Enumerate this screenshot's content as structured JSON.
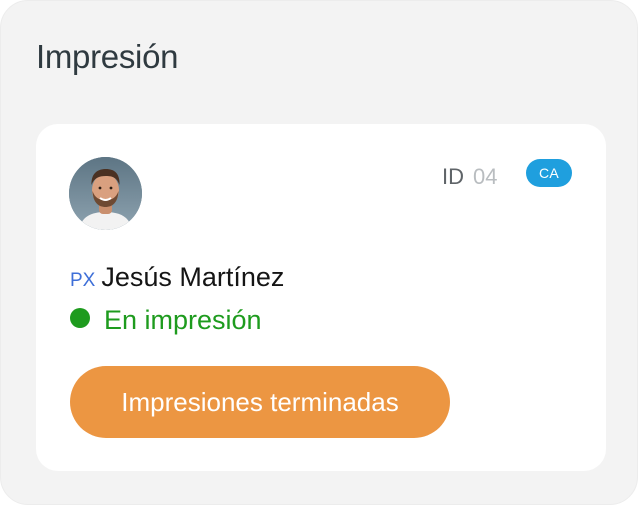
{
  "panel": {
    "title": "Impresión"
  },
  "card": {
    "avatar_icon": "person-avatar-photo",
    "id_label": "ID",
    "id_value": "04",
    "badge": "CA",
    "role_tag": "PX",
    "name": "Jesús Martínez",
    "status": {
      "text": "En impresión",
      "color": "#1e9b1e"
    },
    "action_button": {
      "label": "Impresiones terminadas",
      "color": "#ec9642"
    }
  },
  "colors": {
    "badge": "#1f9fde",
    "role_tag": "#3e6fd8"
  }
}
